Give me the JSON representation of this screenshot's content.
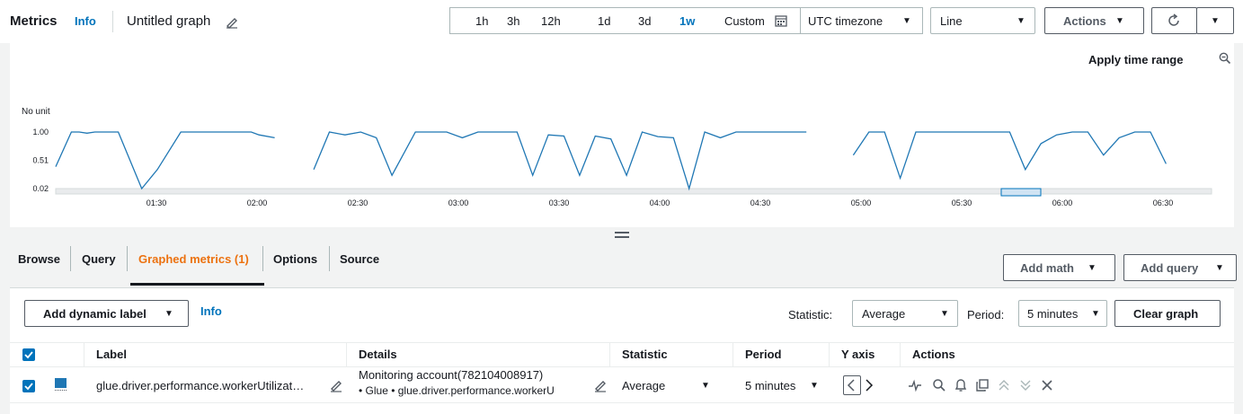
{
  "header": {
    "title": "Metrics",
    "info": "Info",
    "graph_name": "Untitled graph"
  },
  "time_range": {
    "options": [
      "1h",
      "3h",
      "12h",
      "1d",
      "3d",
      "1w"
    ],
    "active": "1w",
    "custom_label": "Custom"
  },
  "timezone": {
    "value": "UTC timezone"
  },
  "graph_type": {
    "value": "Line"
  },
  "actions_button": "Actions",
  "apply_time_range": "Apply time range",
  "chart_data": {
    "type": "line",
    "y_unit_label": "No unit",
    "y_ticks": [
      "1.00",
      "0.51",
      "0.02"
    ],
    "x_ticks": [
      "01:30",
      "02:00",
      "02:30",
      "03:00",
      "03:30",
      "04:00",
      "04:30",
      "05:00",
      "05:30",
      "06:00",
      "06:30"
    ],
    "ylim": [
      0.02,
      1.0
    ],
    "series": [
      {
        "name": "glue.driver.performance.workerUtilization",
        "color": "#1f77b4",
        "segments": [
          [
            [
              0.0,
              0.4
            ],
            [
              0.1,
              1.0
            ],
            [
              0.15,
              1.0
            ],
            [
              0.2,
              0.98
            ],
            [
              0.25,
              1.0
            ],
            [
              0.35,
              1.0
            ],
            [
              0.4,
              1.0
            ],
            [
              0.55,
              0.02
            ],
            [
              0.65,
              0.35
            ],
            [
              0.8,
              1.0
            ],
            [
              1.0,
              1.0
            ],
            [
              1.2,
              1.0
            ],
            [
              1.25,
              1.0
            ],
            [
              1.3,
              0.95
            ],
            [
              1.4,
              0.9
            ]
          ],
          [
            [
              1.65,
              0.35
            ],
            [
              1.75,
              1.0
            ],
            [
              1.85,
              0.95
            ],
            [
              1.95,
              1.0
            ],
            [
              2.05,
              0.9
            ],
            [
              2.15,
              0.25
            ],
            [
              2.3,
              1.0
            ],
            [
              2.5,
              1.0
            ],
            [
              2.6,
              0.9
            ],
            [
              2.7,
              1.0
            ],
            [
              2.85,
              1.0
            ],
            [
              2.95,
              1.0
            ],
            [
              3.05,
              0.25
            ],
            [
              3.15,
              0.95
            ],
            [
              3.25,
              0.93
            ],
            [
              3.35,
              0.25
            ],
            [
              3.45,
              0.93
            ],
            [
              3.55,
              0.88
            ],
            [
              3.65,
              0.25
            ],
            [
              3.75,
              1.0
            ],
            [
              3.85,
              0.92
            ],
            [
              3.95,
              0.9
            ],
            [
              4.05,
              0.02
            ],
            [
              4.15,
              1.0
            ],
            [
              4.25,
              0.9
            ],
            [
              4.35,
              1.0
            ],
            [
              4.5,
              1.0
            ],
            [
              4.65,
              1.0
            ],
            [
              4.8,
              1.0
            ]
          ]
        ],
        "tail_segments": [
          [
            [
              5.1,
              0.6
            ],
            [
              5.2,
              1.0
            ],
            [
              5.3,
              1.0
            ],
            [
              5.4,
              0.2
            ],
            [
              5.5,
              1.0
            ],
            [
              5.7,
              1.0
            ],
            [
              5.9,
              1.0
            ],
            [
              6.1,
              1.0
            ],
            [
              6.2,
              0.35
            ],
            [
              6.3,
              0.8
            ],
            [
              6.4,
              0.95
            ],
            [
              6.5,
              1.0
            ],
            [
              6.6,
              1.0
            ],
            [
              6.7,
              0.6
            ],
            [
              6.8,
              0.9
            ],
            [
              6.9,
              1.0
            ],
            [
              7.0,
              1.0
            ],
            [
              7.1,
              0.45
            ]
          ]
        ]
      }
    ]
  },
  "tabs": [
    {
      "label": "Browse"
    },
    {
      "label": "Query"
    },
    {
      "label": "Graphed metrics (1)"
    },
    {
      "label": "Options"
    },
    {
      "label": "Source"
    }
  ],
  "add_math": "Add math",
  "add_query": "Add query",
  "add_dynamic_label": "Add dynamic label",
  "dynamic_info": "Info",
  "statistic": {
    "label": "Statistic:",
    "value": "Average"
  },
  "period": {
    "label": "Period:",
    "value": "5 minutes"
  },
  "clear_graph": "Clear graph",
  "table": {
    "headers": {
      "label": "Label",
      "details": "Details",
      "statistic": "Statistic",
      "period": "Period",
      "y_axis": "Y axis",
      "actions": "Actions"
    },
    "row": {
      "label": "glue.driver.performance.workerUtilizat…",
      "details_line1": "Monitoring account(782104008917)",
      "details_line2": "• Glue • glue.driver.performance.workerU",
      "statistic": "Average",
      "period": "5 minutes",
      "color": "#1f77b4"
    }
  }
}
